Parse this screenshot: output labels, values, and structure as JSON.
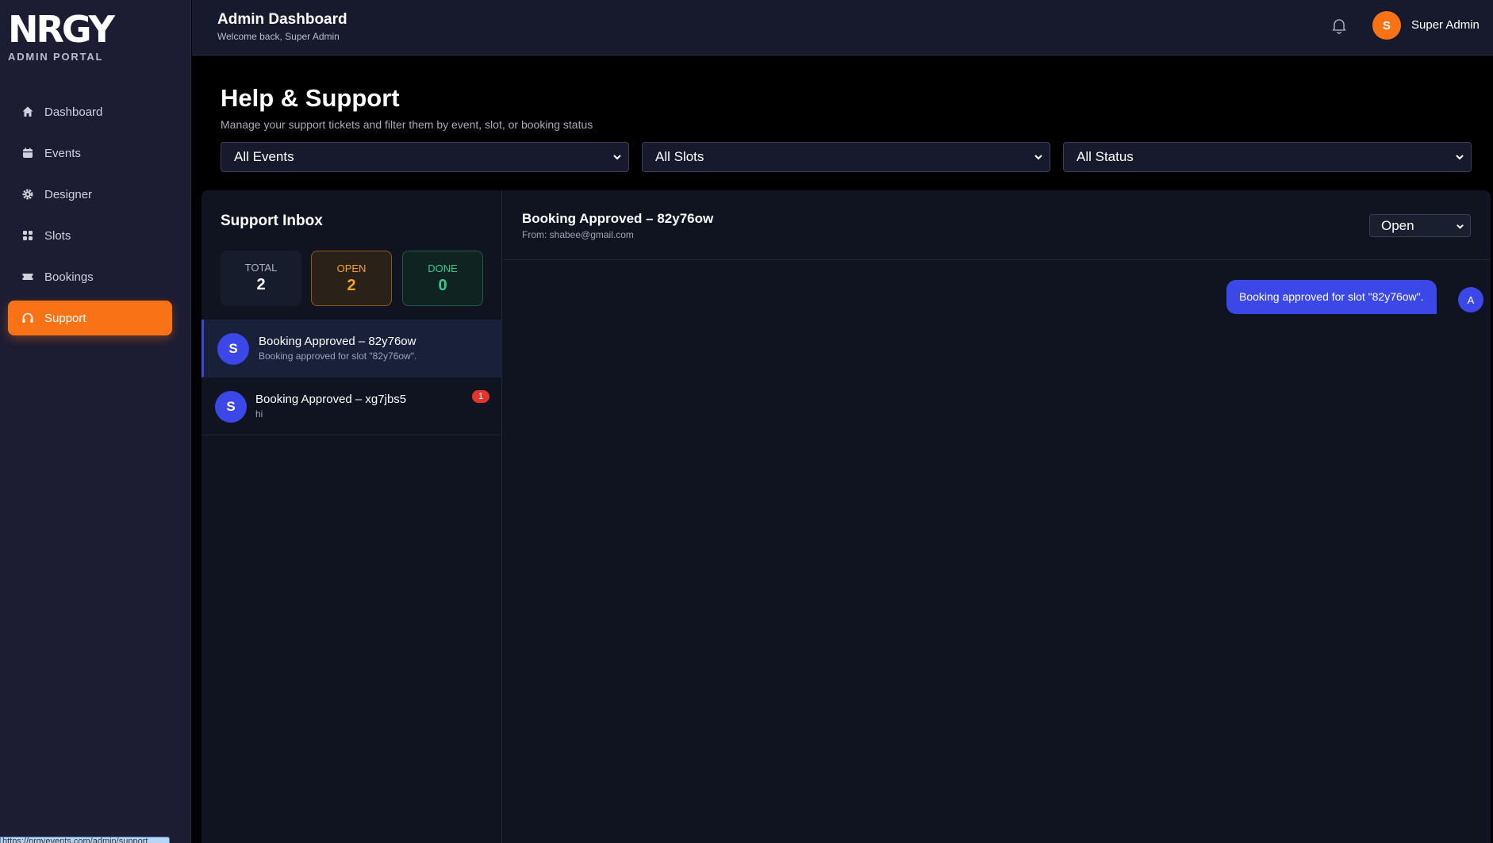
{
  "sidebar": {
    "logo": "NRGY",
    "subtitle": "ADMIN PORTAL",
    "items": [
      {
        "label": "Dashboard",
        "icon": "home-icon"
      },
      {
        "label": "Events",
        "icon": "calendar-icon"
      },
      {
        "label": "Designer",
        "icon": "gear-icon"
      },
      {
        "label": "Slots",
        "icon": "grid-icon"
      },
      {
        "label": "Bookings",
        "icon": "ticket-icon"
      },
      {
        "label": "Support",
        "icon": "headphones-icon",
        "active": true
      }
    ],
    "status_url": "https://nrgyevents.com/admin/support"
  },
  "header": {
    "title": "Admin Dashboard",
    "subtitle": "Welcome back, Super Admin",
    "user_initial": "S",
    "user_name": "Super Admin"
  },
  "page": {
    "title": "Help & Support",
    "subtitle": "Manage your support tickets and filter them by event, slot, or booking status"
  },
  "filters": {
    "events": "All Events",
    "slots": "All Slots",
    "status": "All Status"
  },
  "inbox": {
    "title": "Support Inbox",
    "stats": {
      "total_label": "TOTAL",
      "total": "2",
      "open_label": "OPEN",
      "open": "2",
      "done_label": "DONE",
      "done": "0"
    },
    "tickets": [
      {
        "initial": "S",
        "title": "Booking Approved – 82y76ow",
        "preview": "Booking approved for slot \"82y76ow\".",
        "unread": ""
      },
      {
        "initial": "S",
        "title": "Booking Approved – xg7jbs5",
        "preview": "hi",
        "unread": "1"
      }
    ]
  },
  "conversation": {
    "title": "Booking Approved – 82y76ow",
    "from": "From: shabee@gmail.com",
    "status": "Open",
    "messages": [
      {
        "text": "Booking approved for slot \"82y76ow\".",
        "avatar": "A"
      }
    ]
  },
  "colors": {
    "accent": "#f97316",
    "primary_blue": "#3b47e6",
    "open_amber": "#f6a22a",
    "done_green": "#34c98e",
    "badge_red": "#e3342f"
  }
}
